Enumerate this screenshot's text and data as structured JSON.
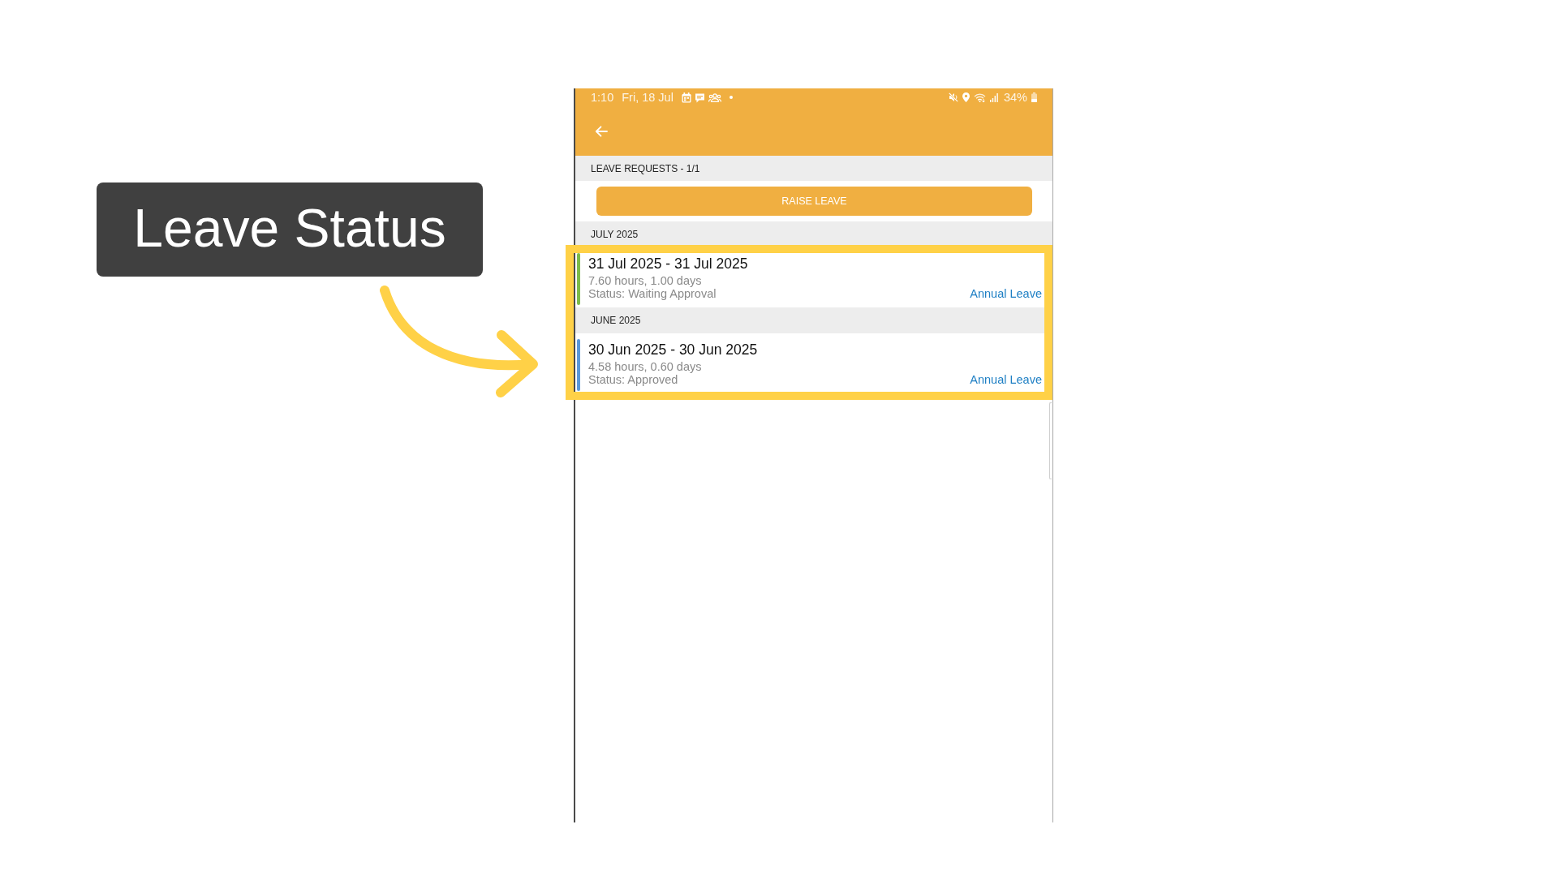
{
  "callout": {
    "text": "Leave Status"
  },
  "status_bar": {
    "time": "1:10",
    "date": "Fri, 18 Jul",
    "battery": "34%"
  },
  "list_header": "LEAVE REQUESTS - 1/1",
  "raise_button": "RAISE LEAVE",
  "months": [
    {
      "label": "JULY 2025",
      "requests": [
        {
          "dates": "31 Jul 2025 - 31 Jul 2025",
          "duration": "7.60 hours, 1.00 days",
          "status": "Status: Waiting Approval",
          "leave_type": "Annual Leave",
          "color": "#7cbb4a"
        }
      ]
    },
    {
      "label": "JUNE 2025",
      "requests": [
        {
          "dates": "30 Jun 2025 - 30 Jun 2025",
          "duration": "4.58 hours, 0.60 days",
          "status": "Status: Approved",
          "leave_type": "Annual Leave",
          "color": "#5a98da"
        }
      ]
    }
  ]
}
